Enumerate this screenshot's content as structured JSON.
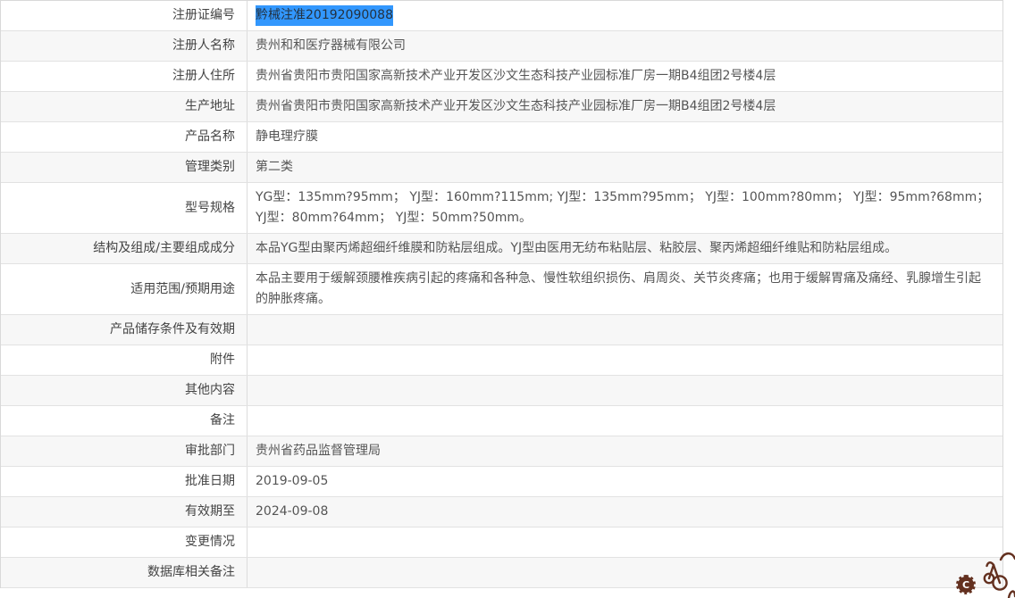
{
  "table": {
    "stripe_color": "#f7f7f7",
    "border_color": "#d9d9d9",
    "rows": [
      {
        "label": "注册证编号",
        "value": "黔械注准20192090088",
        "highlighted": true
      },
      {
        "label": "注册人名称",
        "value": "贵州和和医疗器械有限公司"
      },
      {
        "label": "注册人住所",
        "value": "贵州省贵阳市贵阳国家高新技术产业开发区沙文生态科技产业园标准厂房一期B4组团2号楼4层"
      },
      {
        "label": "生产地址",
        "value": "贵州省贵阳市贵阳国家高新技术产业开发区沙文生态科技产业园标准厂房一期B4组团2号楼4层"
      },
      {
        "label": "产品名称",
        "value": "静电理疗膜"
      },
      {
        "label": "管理类别",
        "value": "第二类"
      },
      {
        "label": "型号规格",
        "value": "YG型：135mm?95mm； YJ型：160mm?115mm; YJ型：135mm?95mm； YJ型：100mm?80mm； YJ型：95mm?68mm； YJ型：80mm?64mm； YJ型：50mm?50mm。"
      },
      {
        "label": "结构及组成/主要组成成分",
        "value": "本品YG型由聚丙烯超细纤维膜和防粘层组成。YJ型由医用无纺布粘贴层、粘胶层、聚丙烯超细纤维贴和防粘层组成。"
      },
      {
        "label": "适用范围/预期用途",
        "value": "本品主要用于缓解颈腰椎疾病引起的疼痛和各种急、慢性软组织损伤、肩周炎、关节炎疼痛；也用于缓解胃痛及痛经、乳腺增生引起的肿胀疼痛。"
      },
      {
        "label": "产品储存条件及有效期",
        "value": ""
      },
      {
        "label": "附件",
        "value": ""
      },
      {
        "label": "其他内容",
        "value": ""
      },
      {
        "label": "备注",
        "value": ""
      },
      {
        "label": "审批部门",
        "value": "贵州省药品监督管理局"
      },
      {
        "label": "批准日期",
        "value": "2019-09-05"
      },
      {
        "label": "有效期至",
        "value": "2024-09-08"
      },
      {
        "label": "变更情况",
        "value": ""
      },
      {
        "label": "数据库相关备注",
        "value": ""
      }
    ]
  },
  "selection": {
    "background": "#3297fd",
    "text_color": "#23313f"
  },
  "decoration": {
    "color": "#63301f",
    "badge_letter": "C"
  }
}
